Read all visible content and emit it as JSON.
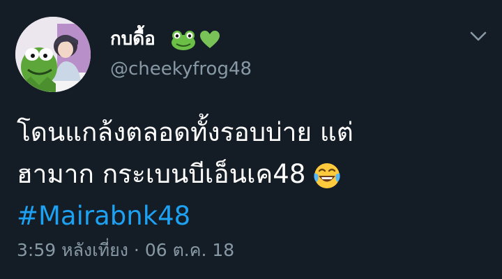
{
  "tweet": {
    "display_name": "กบดื้อ",
    "name_emojis": [
      "frog-icon",
      "green-heart-icon"
    ],
    "handle": "@cheekyfrog48",
    "text_lines": [
      "โดนแกล้งตลอดทั้งรอบบ่าย แต่",
      "ฮามาก กระเบนบีเอ็นเค48"
    ],
    "text_emoji": "tears-of-joy-icon",
    "hashtag": "#Mairabnk48",
    "timestamp": "3:59 หลังเที่ยง · 06 ต.ค. 18"
  },
  "colors": {
    "background": "#141d26",
    "text": "#ffffff",
    "secondary": "#8899a6",
    "link": "#1da1f2"
  }
}
